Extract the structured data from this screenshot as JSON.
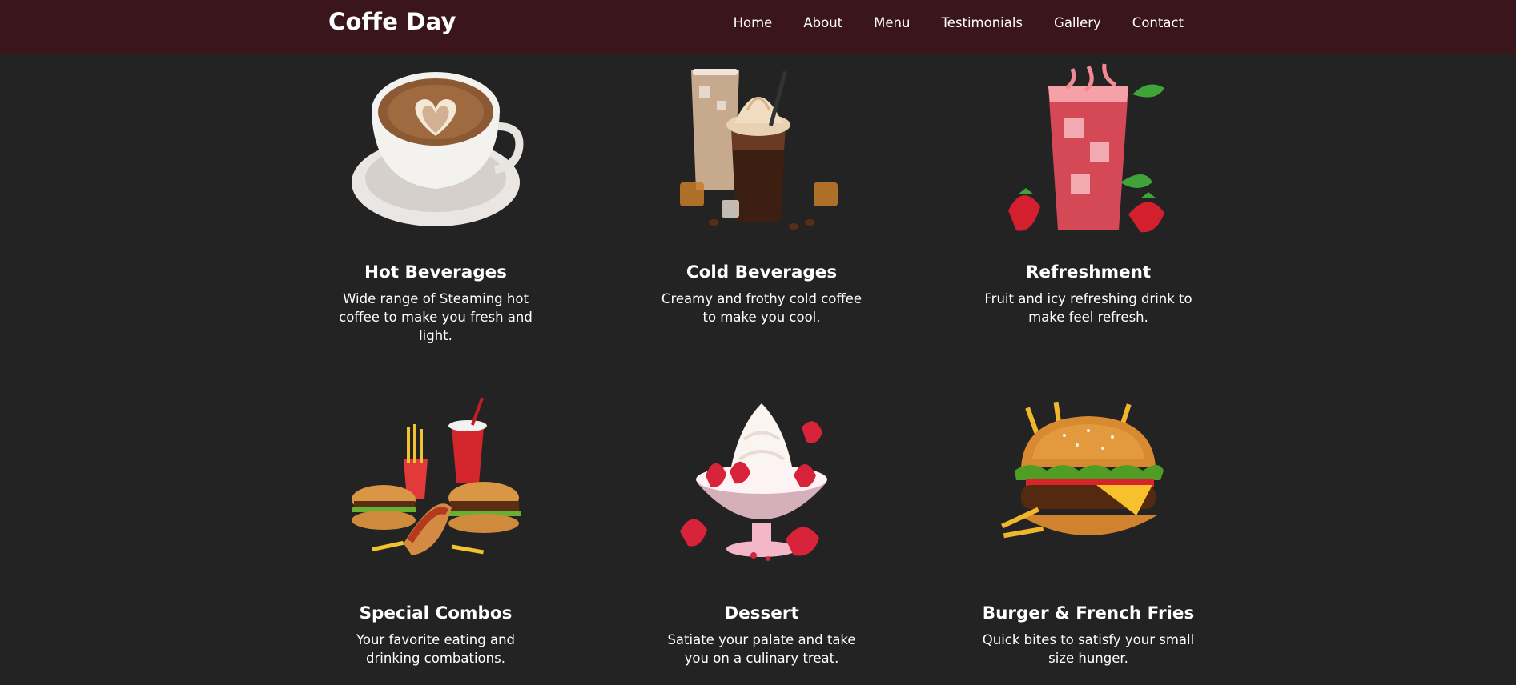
{
  "brand": "Coffe Day",
  "nav": [
    {
      "label": "Home"
    },
    {
      "label": "About"
    },
    {
      "label": "Menu"
    },
    {
      "label": "Testimonials"
    },
    {
      "label": "Gallery"
    },
    {
      "label": "Contact"
    }
  ],
  "cards": [
    {
      "title": "Hot Beverages",
      "desc": "Wide range of Steaming hot coffee to make you fresh and light.",
      "icon": "coffee-cup-image"
    },
    {
      "title": "Cold Beverages",
      "desc": "Creamy and frothy cold coffee to make you cool.",
      "icon": "iced-coffee-image"
    },
    {
      "title": "Refreshment",
      "desc": "Fruit and icy refreshing drink to make feel refresh.",
      "icon": "strawberry-drink-image"
    },
    {
      "title": "Special Combos",
      "desc": "Your favorite eating and drinking combations.",
      "icon": "combo-meal-image"
    },
    {
      "title": "Dessert",
      "desc": "Satiate your palate and take you on a culinary treat.",
      "icon": "strawberry-sundae-image"
    },
    {
      "title": "Burger & French Fries",
      "desc": "Quick bites to satisfy your small size hunger.",
      "icon": "burger-fries-image"
    }
  ],
  "colors": {
    "navbar_bg": "#3a161c",
    "page_bg": "#232323",
    "text": "#ffffff"
  }
}
